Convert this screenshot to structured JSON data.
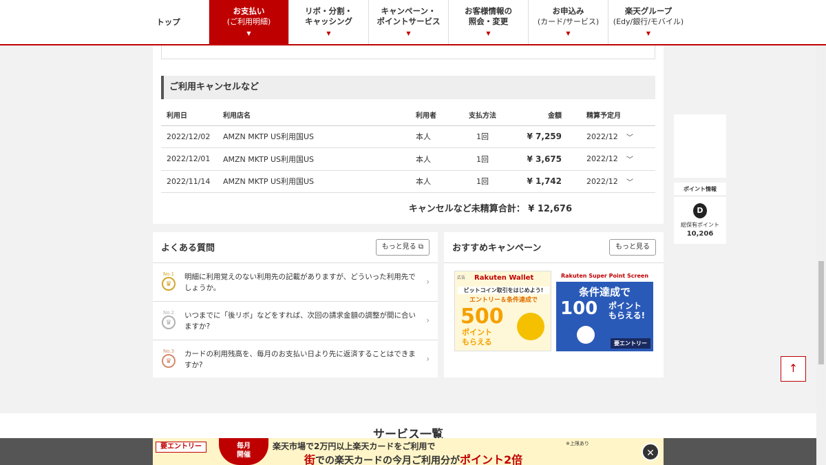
{
  "nav": {
    "items": [
      {
        "label": "トップ",
        "sub": ""
      },
      {
        "label": "お支払い",
        "sub": "(ご利用明細)"
      },
      {
        "label": "リボ・分割・",
        "sub": "キャッシング"
      },
      {
        "label": "キャンペーン・",
        "sub": "ポイントサービス"
      },
      {
        "label": "お客様情報の",
        "sub": "照会・変更"
      },
      {
        "label": "お申込み",
        "sub": "(カード/サービス)"
      },
      {
        "label": "楽天グループ",
        "sub": "(Edy/銀行/モバイル)"
      }
    ]
  },
  "cancel": {
    "heading": "ご利用キャンセルなど",
    "columns": [
      "利用日",
      "利用店名",
      "利用者",
      "支払方法",
      "金額",
      "精算予定月"
    ],
    "rows": [
      {
        "date": "2022/12/02",
        "store": "AMZN MKTP US利用国US",
        "user": "本人",
        "method": "1回",
        "amount": "¥ 7,259",
        "month": "2022/12"
      },
      {
        "date": "2022/12/01",
        "store": "AMZN MKTP US利用国US",
        "user": "本人",
        "method": "1回",
        "amount": "¥ 3,675",
        "month": "2022/12"
      },
      {
        "date": "2022/11/14",
        "store": "AMZN MKTP US利用国US",
        "user": "本人",
        "method": "1回",
        "amount": "¥ 1,742",
        "month": "2022/12"
      }
    ],
    "total_label": "キャンセルなど未精算合計：",
    "total_value": "¥ 12,676"
  },
  "faq": {
    "title": "よくある質問",
    "more": "もっと見る",
    "items": [
      {
        "rank": "No.1",
        "text": "明細に利用覚えのない利用先の記載がありますが、どういった利用先でしょうか。"
      },
      {
        "rank": "No.2",
        "text": "いつまでに「後リボ」などをすれば、次回の請求金額の調整が間に合いますか?"
      },
      {
        "rank": "No.3",
        "text": "カードの利用残高を、毎月のお支払い日より先に返済することはできますか?"
      }
    ]
  },
  "campaign": {
    "title": "おすすめキャンペーン",
    "more": "もっと見る",
    "banner1": {
      "ad": "広告",
      "brand": "Rakuten Wallet",
      "line1": "ビットコイン取引をはじめよう!",
      "line2": "エントリー＆条件達成で",
      "big": "500",
      "unit1": "ポイント",
      "unit2": "もらえる"
    },
    "banner2": {
      "brand": "Rakuten Super Point Screen",
      "line1": "条件達成で",
      "big": "100",
      "unit1": "ポイント",
      "unit2": "もらえる!",
      "tag": "要エントリー"
    }
  },
  "side": {
    "points_header": "ポイント情報",
    "points_label": "総保有ポイント",
    "points_value": "10,206"
  },
  "service": {
    "title": "サービス一覧"
  },
  "bottom_bar": {
    "entry": "要エントリー",
    "monthly1": "毎月",
    "monthly2": "開催",
    "msg1": "楽天市場で2万円以上楽天カードをご利用で",
    "msg2a": "街",
    "msg2b": "での楽天カードの今月ご利用分が",
    "msg2c": "ポイント2倍",
    "limit": "※上限あり"
  }
}
